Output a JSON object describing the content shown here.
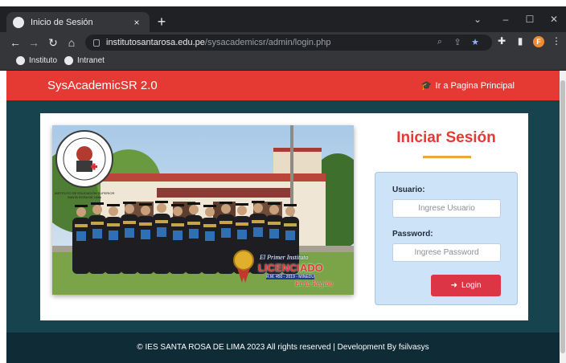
{
  "browser": {
    "tab_title": "Inicio de Sesión",
    "tab_close": "×",
    "new_tab": "+",
    "url_host": "institutosantarosa.edu.pe",
    "url_path": "/sysacademicsr/admin/login.php",
    "profile_initial": "F",
    "bookmarks": [
      {
        "label": "Instituto",
        "icon": "instituto-favicon"
      },
      {
        "label": "Intranet",
        "icon": "intranet-favicon"
      }
    ]
  },
  "navbar": {
    "brand": "SysAcademicSR 2.0",
    "link_label": "Ir a Pagina Principal",
    "link_icon": "graduation-cap-icon"
  },
  "photo": {
    "seal_text": "INSTITUTO DE EDUCACIÓN SUPERIOR SANTA ROSA DE LIMA",
    "banner_line1": "El Primer Instituto",
    "banner_line2": "LICENCIADO",
    "banner_line3": "R.M. 450 - 2019 - MINEDU",
    "banner_line4": "En la Región"
  },
  "login": {
    "title": "Iniciar Sesión",
    "username_label": "Usuario:",
    "username_placeholder": "Ingrese Usuario",
    "username_value": "",
    "password_label": "Password:",
    "password_placeholder": "Ingrese Password",
    "password_value": "",
    "button_label": "Login",
    "button_icon": "sign-in-icon"
  },
  "footer": {
    "text": "© IES SANTA ROSA DE LIMA 2023 All rights reserved | Development By fsilvasys"
  },
  "colors": {
    "navbar": "#e53a34",
    "page_bg": "#17434f",
    "footer_bg": "#0f2b36",
    "login_button": "#dc3545",
    "login_box": "#cde3f7",
    "title_rule": "#f2a33a"
  }
}
